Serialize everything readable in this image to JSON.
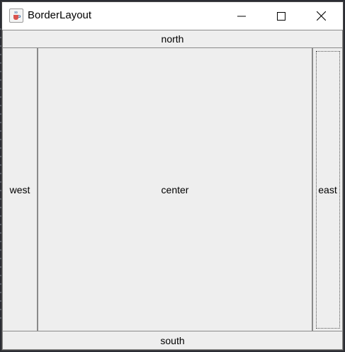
{
  "window": {
    "title": "BorderLayout",
    "icon": "java-cup-icon",
    "controls": [
      "minimize-icon",
      "maximize-icon",
      "close-icon"
    ]
  },
  "layout": {
    "north_label": "north",
    "west_label": "west",
    "center_label": "center",
    "east_label": "east",
    "south_label": "south",
    "focused": "east"
  },
  "colors": {
    "panel_bg": "#eeeeee",
    "titlebar_bg": "#ffffff",
    "border": "#8a8a8a",
    "backdrop": "#2b2d33"
  }
}
